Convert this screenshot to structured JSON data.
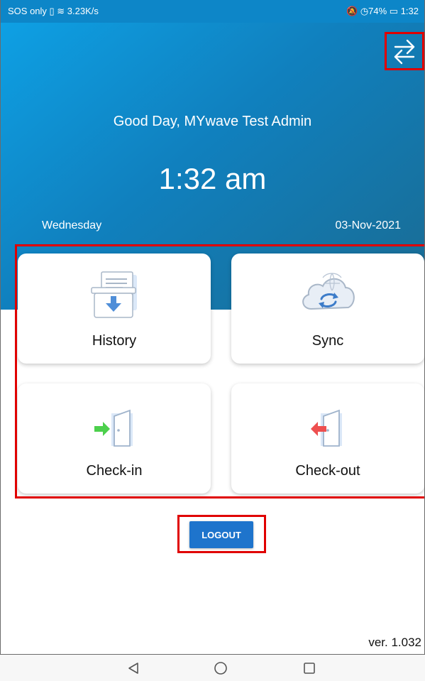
{
  "status_bar": {
    "left_text": "SOS only ▯ ≋ 3.23K/s",
    "right_text": "🔕 ◷74% ▭ 1:32"
  },
  "header": {
    "greeting": "Good Day, MYwave Test Admin",
    "time": "1:32 am",
    "day": "Wednesday",
    "date": "03-Nov-2021",
    "switch_icon": "swap-arrows-icon"
  },
  "tiles": [
    {
      "label": "History",
      "icon": "history-tray-icon"
    },
    {
      "label": "Sync",
      "icon": "cloud-sync-icon"
    },
    {
      "label": "Check-in",
      "icon": "door-enter-icon"
    },
    {
      "label": "Check-out",
      "icon": "door-exit-icon"
    }
  ],
  "logout": {
    "label": "LOGOUT"
  },
  "version": "ver. 1.032",
  "nav": {
    "back_icon": "back-triangle-icon",
    "home_icon": "home-circle-icon",
    "recents_icon": "recents-square-icon"
  },
  "colors": {
    "header": "#1080be",
    "accent": "#1e74cc",
    "highlight": "#e00000"
  }
}
